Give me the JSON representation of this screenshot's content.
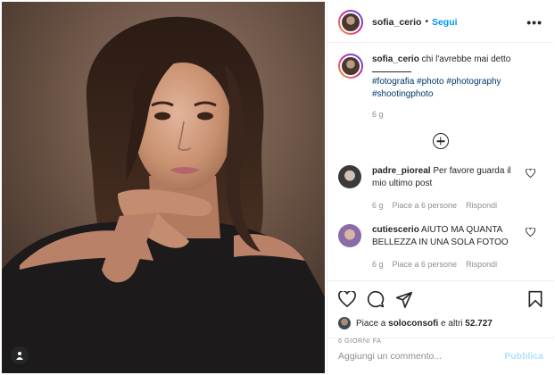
{
  "post": {
    "username": "sofia_cerio",
    "follow_label": "Segui",
    "separator": "•",
    "more_label": "•••"
  },
  "caption": {
    "username": "sofia_cerio",
    "text": "chi l'avrebbe mai detto",
    "hashtags": "#fotografia #photo #photography #shootingphoto",
    "time": "6 g"
  },
  "comments": [
    {
      "username": "padre_pioreal",
      "text": "Per favore guarda il mio ultimo post",
      "time": "6 g",
      "likes": "Piace a 6 persone",
      "reply": "Rispondi"
    },
    {
      "username": "cutiescerio",
      "text": "AIUTO MA QUANTA BELLEZZA IN UNA SOLA FOTOO",
      "time": "6 g",
      "likes": "Piace a 6 persone",
      "reply": "Rispondi"
    }
  ],
  "likes": {
    "prefix": "Piace a",
    "user": "soloconsofi",
    "middle": "e altri",
    "count": "52.727"
  },
  "posted_ago": "6 GIORNI FA",
  "add_comment": {
    "placeholder": "Aggiungi un commento...",
    "publish": "Pubblica"
  },
  "colors": {
    "link": "#0095f6",
    "hashtag": "#00376b",
    "muted": "#8e8e8e",
    "publish_disabled": "#b2dffc"
  },
  "icons": [
    "tag-user-icon",
    "more-options-icon",
    "plus-circle-icon",
    "heart-icon",
    "comment-icon",
    "share-icon",
    "bookmark-icon"
  ]
}
